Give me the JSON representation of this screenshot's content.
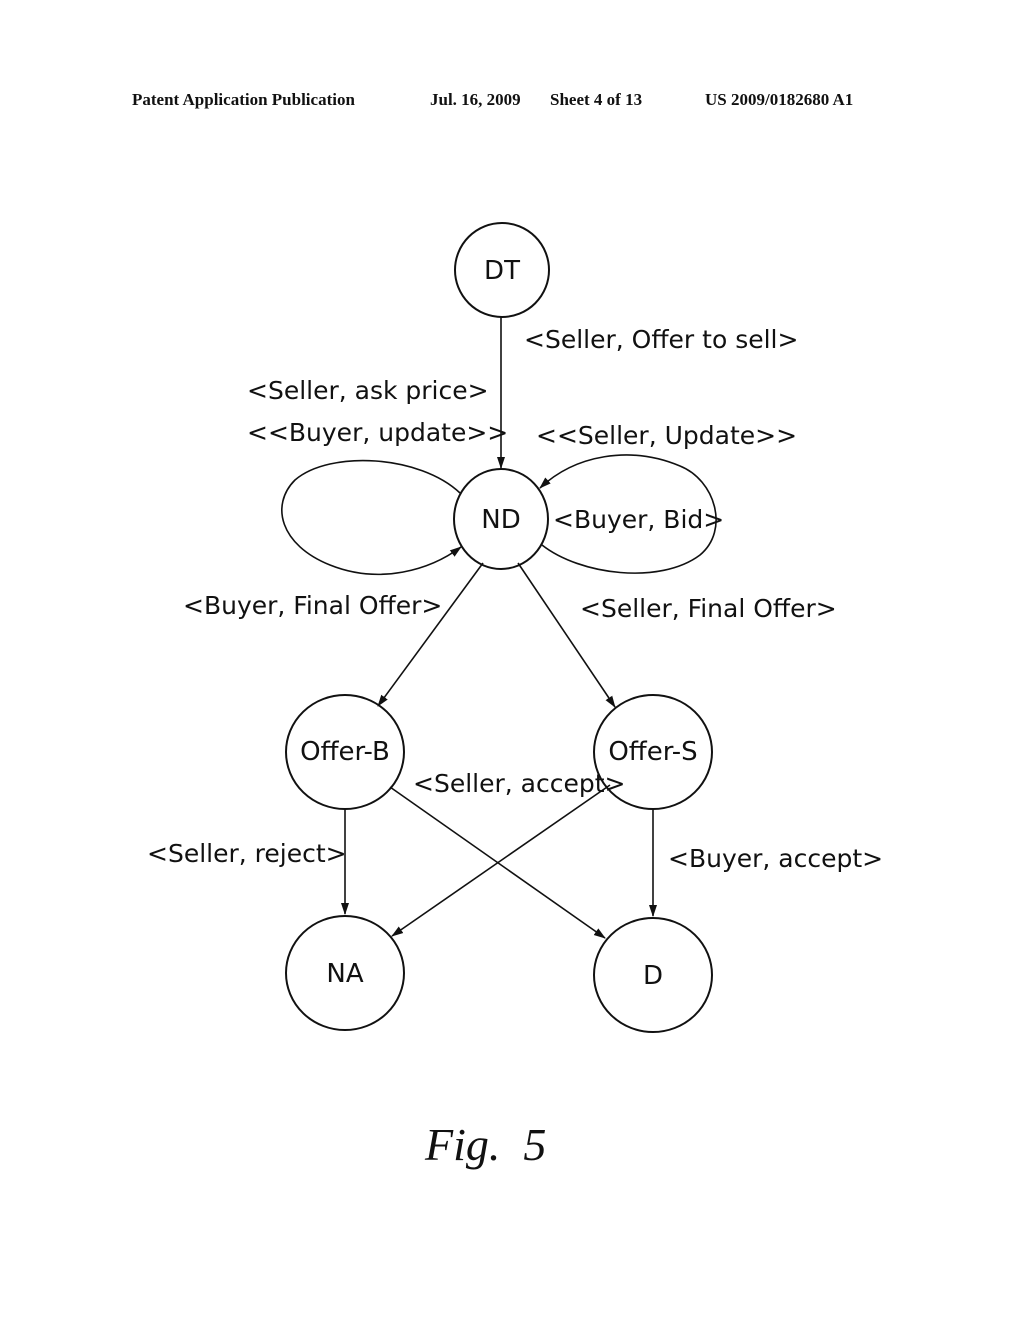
{
  "header": {
    "left": "Patent Application Publication",
    "date": "Jul. 16, 2009",
    "sheet": "Sheet 4 of 13",
    "pub_number": "US 2009/0182680 A1"
  },
  "figure_caption": "Fig.  5",
  "diagram": {
    "type": "state-transition",
    "nodes": [
      {
        "id": "DT",
        "label": "DT"
      },
      {
        "id": "ND",
        "label": "ND"
      },
      {
        "id": "OB",
        "label": "Offer-B"
      },
      {
        "id": "OS",
        "label": "Offer-S"
      },
      {
        "id": "NA",
        "label": "NA"
      },
      {
        "id": "D",
        "label": "D"
      }
    ],
    "edges": [
      {
        "from": "DT",
        "to": "ND",
        "label": "<Seller, Offer to sell>"
      },
      {
        "from": "ND",
        "to": "ND",
        "label_1": "<Seller, ask price>",
        "label_2": "<<Buyer, update>>",
        "side": "left"
      },
      {
        "from": "ND",
        "to": "ND",
        "label_1": "<<Seller, Update>>",
        "label_2": "<Buyer, Bid>",
        "side": "right"
      },
      {
        "from": "ND",
        "to": "OB",
        "label": "<Buyer, Final Offer>"
      },
      {
        "from": "ND",
        "to": "OS",
        "label": "<Seller, Final Offer>"
      },
      {
        "from": "OB",
        "to": "NA",
        "label": "<Seller, reject>"
      },
      {
        "from": "OB",
        "to": "D",
        "label": "<Seller, accept>"
      },
      {
        "from": "OS",
        "to": "NA",
        "label": ""
      },
      {
        "from": "OS",
        "to": "D",
        "label": "<Buyer, accept>"
      }
    ]
  }
}
